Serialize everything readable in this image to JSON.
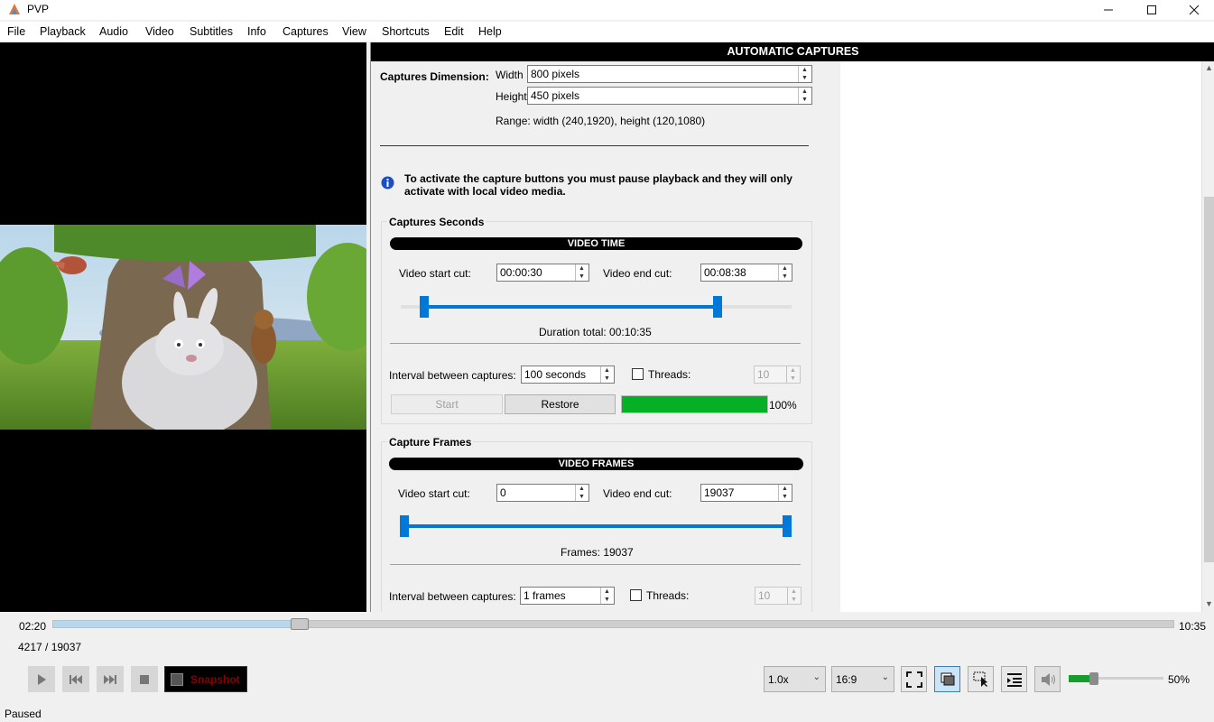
{
  "window": {
    "title": "PVP"
  },
  "menu": [
    "File",
    "Playback",
    "Audio",
    "Video",
    "Subtitles",
    "Info",
    "Captures",
    "View",
    "Shortcuts",
    "Edit",
    "Help"
  ],
  "panel": {
    "header": "AUTOMATIC CAPTURES",
    "dimension": {
      "label": "Captures Dimension:",
      "width_label": "Width",
      "width_value": "800 pixels",
      "height_label": "Height",
      "height_value": "450 pixels",
      "range_text": "Range: width (240,1920), height (120,1080)"
    },
    "info_text_1": "To activate the capture buttons you must pause playback and they will only",
    "info_text_2": "activate with local video media.",
    "seconds": {
      "group_label": "Captures Seconds",
      "band": "VIDEO TIME",
      "start_label": "Video start cut:",
      "start_value": "00:00:30",
      "end_label": "Video end cut:",
      "end_value": "00:08:38",
      "duration_text": "Duration total: 00:10:35",
      "interval_label": "Interval between captures:",
      "interval_value": "100 seconds",
      "threads_label": "Threads:",
      "threads_value": "10",
      "start_button": "Start",
      "restore_button": "Restore",
      "progress_percent": "100%",
      "progress_fraction": 1.0,
      "range_start_fraction": 0.06,
      "range_end_fraction": 0.81
    },
    "frames": {
      "group_label": "Capture Frames",
      "band": "VIDEO FRAMES",
      "start_label": "Video start cut:",
      "start_value": "0",
      "end_label": "Video end cut:",
      "end_value": "19037",
      "frames_text": "Frames: 19037",
      "interval_label": "Interval between captures:",
      "interval_value": "1 frames",
      "threads_label": "Threads:",
      "threads_value": "10"
    }
  },
  "player": {
    "elapsed": "02:20",
    "total": "10:35",
    "frame_counter": "4217 / 19037",
    "seek_fraction": 0.22,
    "snapshot_label": "Snapshot",
    "speed": "1.0x",
    "aspect": "16:9",
    "volume_percent": "50%",
    "volume_fraction": 0.27,
    "status": "Paused"
  },
  "colors": {
    "accent": "#0078d7",
    "progress": "#06b025",
    "volume": "#1a9b2e"
  }
}
